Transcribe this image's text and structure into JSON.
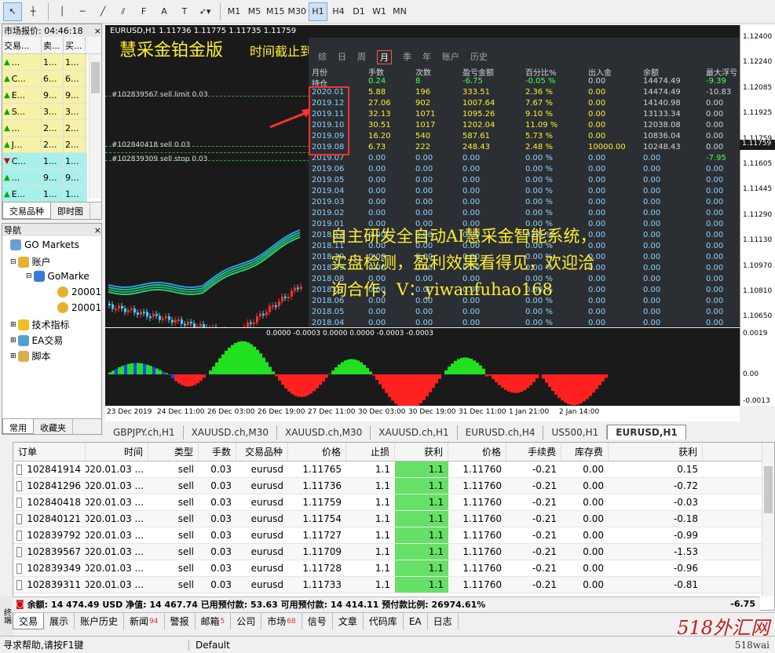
{
  "toolbar": {
    "timeframes": [
      "M1",
      "M5",
      "M15",
      "M30",
      "H1",
      "H4",
      "D1",
      "W1",
      "MN"
    ],
    "active": "H1"
  },
  "market_watch": {
    "title": "市场报价: 04:46:18",
    "headers": [
      "交易...",
      "卖...",
      "买..."
    ],
    "rows": [
      {
        "sym": "...",
        "bid": "1...",
        "ask": "1...",
        "dir": "up",
        "bg": "#f6f2a8"
      },
      {
        "sym": "C...",
        "bid": "6...",
        "ask": "6...",
        "dir": "up",
        "bg": "#f6f2a8"
      },
      {
        "sym": "E...",
        "bid": "9...",
        "ask": "9...",
        "dir": "up",
        "bg": "#f6f2a8"
      },
      {
        "sym": "S...",
        "bid": "3...",
        "ask": "3...",
        "dir": "up",
        "bg": "#f6f2a8"
      },
      {
        "sym": "...",
        "bid": "2...",
        "ask": "2...",
        "dir": "up",
        "bg": "#f6f2a8"
      },
      {
        "sym": "J...",
        "bid": "2...",
        "ask": "2...",
        "dir": "up",
        "bg": "#f6f2a8"
      },
      {
        "sym": "C...",
        "bid": "1...",
        "ask": "1...",
        "dir": "down",
        "bg": "#a8f0ea"
      },
      {
        "sym": "...",
        "bid": "9...",
        "ask": "9...",
        "dir": "up",
        "bg": "#a8f0ea"
      },
      {
        "sym": "E...",
        "bid": "1...",
        "ask": "1...",
        "dir": "up",
        "bg": "#a8f0ea"
      }
    ],
    "tabs": [
      "交易品种",
      "即时图"
    ]
  },
  "navigator": {
    "title": "导航",
    "items": [
      "GO Markets",
      "账户",
      "GoMarke",
      "20001",
      "20001",
      "技术指标",
      "EA交易",
      "脚本"
    ],
    "tabs": [
      "常用",
      "收藏夹"
    ]
  },
  "chart": {
    "header": "EURUSD,H1  1.11736 1.11775 1.11735 1.11759",
    "overlay_title": "慧采金铂金版",
    "overlay_notice": "时间截止到 2020.05.11，到期请联系客服!",
    "order_lines": [
      "#102839567 sell limit 0.03",
      "#102840418 sell 0.03",
      "#102839309 sell stop 0.03"
    ],
    "promo": [
      "自主研发全自动AI慧采金智能系统，",
      "实盘检测，盈利效果看得见，欢迎洽",
      "询合作，V：yiwanfuhao168"
    ],
    "price_axis": [
      "1.12400",
      "1.12240",
      "1.12085",
      "1.11925",
      "1.11759",
      "1.11605",
      "1.11445",
      "1.11290",
      "1.11130",
      "1.10970",
      "1.10810",
      "1.10650"
    ],
    "ind_axis": [
      "0.0019",
      "0.00",
      "-0.0013"
    ],
    "ind_header": "0.0000 -0.0003 0.0000 0.0000 -0.0003 -0.0003",
    "time_axis": [
      "23 Dec 2019",
      "24 Dec 11:00",
      "26 Dec 03:00",
      "26 Dec 19:00",
      "27 Dec 11:00",
      "30 Dec 03:00",
      "30 Dec 19:00",
      "31 Dec 11:00",
      "1 Jan 21:00",
      "2 Jan 14:00"
    ]
  },
  "stats": {
    "tabs": [
      "综",
      "日",
      "周",
      "月",
      "季",
      "年",
      "账户",
      "历史"
    ],
    "headers": [
      "月份",
      "手数",
      "次数",
      "盈亏金额",
      "百分比%",
      "出入金",
      "余额",
      "最大浮亏"
    ],
    "position_row": [
      "持仓",
      "0.24",
      "8",
      "-6.75",
      "-0.05 %",
      "0.00",
      "14474.49",
      "-9.39"
    ],
    "rows": [
      [
        "2020.01",
        "5.88",
        "196",
        "333.51",
        "2.36 %",
        "0.00",
        "14474.49",
        "-10.83"
      ],
      [
        "2019.12",
        "27.06",
        "902",
        "1007.64",
        "7.67 %",
        "0.00",
        "14140.98",
        "0.00"
      ],
      [
        "2019.11",
        "32.13",
        "1071",
        "1095.26",
        "9.10 %",
        "0.00",
        "13133.34",
        "0.00"
      ],
      [
        "2019.10",
        "30.51",
        "1017",
        "1202.04",
        "11.09 %",
        "0.00",
        "12038.08",
        "0.00"
      ],
      [
        "2019.09",
        "16.20",
        "540",
        "587.61",
        "5.73 %",
        "0.00",
        "10836.04",
        "0.00"
      ],
      [
        "2019.08",
        "6.73",
        "222",
        "248.43",
        "2.48 %",
        "10000.00",
        "10248.43",
        "0.00"
      ],
      [
        "2019.07",
        "0.00",
        "0.00",
        "0.00",
        "0.00 %",
        "0.00",
        "0.00",
        "-7.95"
      ],
      [
        "2019.06",
        "0.00",
        "0.00",
        "0.00",
        "0.00 %",
        "0.00",
        "0.00",
        "0.00"
      ],
      [
        "2019.05",
        "0.00",
        "0.00",
        "0.00",
        "0.00 %",
        "0.00",
        "0.00",
        "0.00"
      ],
      [
        "2019.04",
        "0.00",
        "0.00",
        "0.00",
        "0.00 %",
        "0.00",
        "0.00",
        "0.00"
      ],
      [
        "2019.03",
        "0.00",
        "0.00",
        "0.00",
        "0.00 %",
        "0.00",
        "0.00",
        "0.00"
      ],
      [
        "2019.02",
        "0.00",
        "0.00",
        "0.00",
        "0.00 %",
        "0.00",
        "0.00",
        "0.00"
      ],
      [
        "2019.01",
        "0.00",
        "0.00",
        "0.00",
        "0.00 %",
        "0.00",
        "0.00",
        "0.00"
      ],
      [
        "2018.12",
        "0.00",
        "0.00",
        "0.00",
        "0.00 %",
        "0.00",
        "0.00",
        "0.00"
      ],
      [
        "2018.11",
        "0.00",
        "0.00",
        "0.00",
        "0.00 %",
        "0.00",
        "0.00",
        "0.00"
      ],
      [
        "2018.10",
        "0.00",
        "0.00",
        "0.00",
        "0.00 %",
        "0.00",
        "0.00",
        "0.00"
      ],
      [
        "2018.09",
        "0.00",
        "0.00",
        "0.00",
        "0.00 %",
        "0.00",
        "0.00",
        "0.00"
      ],
      [
        "2018.08",
        "0.00",
        "0.00",
        "0.00",
        "0.00 %",
        "0.00",
        "0.00",
        "0.00"
      ],
      [
        "2018.07",
        "0.00",
        "0.00",
        "0.00",
        "0.00 %",
        "0.00",
        "0.00",
        "0.00"
      ],
      [
        "2018.06",
        "0.00",
        "0.00",
        "0.00",
        "0.00 %",
        "0.00",
        "0.00",
        "0.00"
      ],
      [
        "2018.05",
        "0.00",
        "0.00",
        "0.00",
        "0.00 %",
        "0.00",
        "0.00",
        "0.00"
      ],
      [
        "2018.04",
        "0.00",
        "0.00",
        "0.00",
        "0.00 %",
        "0.00",
        "0.00",
        "0.00"
      ]
    ]
  },
  "chart_tabs": [
    "GBPJPY.ch,H1",
    "XAUUSD.ch,M30",
    "XAUUSD.ch,M30",
    "XAUUSD.ch,H1",
    "EURUSD.ch,H4",
    "US500,H1",
    "EURUSD,H1"
  ],
  "trade": {
    "headers": [
      "订单",
      "时间",
      "类型",
      "手数",
      "交易品种",
      "价格",
      "止损",
      "获利",
      "价格",
      "手续费",
      "库存费",
      "获利"
    ],
    "rows": [
      [
        "102841914",
        "2020.01.03 ...",
        "sell",
        "0.03",
        "eurusd",
        "1.11765",
        "1.1",
        "1.1",
        "1.11760",
        "-0.21",
        "0.00",
        "0.15"
      ],
      [
        "102841296",
        "2020.01.03 ...",
        "sell",
        "0.03",
        "eurusd",
        "1.11736",
        "1.1",
        "1.1",
        "1.11760",
        "-0.21",
        "0.00",
        "-0.72"
      ],
      [
        "102840418",
        "2020.01.03 ...",
        "sell",
        "0.03",
        "eurusd",
        "1.11759",
        "1.1",
        "1.1",
        "1.11760",
        "-0.21",
        "0.00",
        "-0.03"
      ],
      [
        "102840121",
        "2020.01.03 ...",
        "sell",
        "0.03",
        "eurusd",
        "1.11754",
        "1.1",
        "1.1",
        "1.11760",
        "-0.21",
        "0.00",
        "-0.18"
      ],
      [
        "102839792",
        "2020.01.03 ...",
        "sell",
        "0.03",
        "eurusd",
        "1.11727",
        "1.1",
        "1.1",
        "1.11760",
        "-0.21",
        "0.00",
        "-0.99"
      ],
      [
        "102839567",
        "2020.01.03 ...",
        "sell",
        "0.03",
        "eurusd",
        "1.11709",
        "1.1",
        "1.1",
        "1.11760",
        "-0.21",
        "0.00",
        "-1.53"
      ],
      [
        "102839349",
        "2020.01.03 ...",
        "sell",
        "0.03",
        "eurusd",
        "1.11728",
        "1.1",
        "1.1",
        "1.11760",
        "-0.21",
        "0.00",
        "-0.96"
      ],
      [
        "102839311",
        "2020.01.03 ...",
        "sell",
        "0.03",
        "eurusd",
        "1.11733",
        "1.1",
        "1.1",
        "1.11760",
        "-0.21",
        "0.00",
        "-0.81"
      ]
    ],
    "balance_line": "余额: 14 474.49 USD  净值: 14 467.74  已用预付款: 53.63  可用预付款: 14 414.11  预付款比例: 26974.61%",
    "balance_total": "-6.75",
    "tabs": [
      {
        "l": "交易",
        "b": ""
      },
      {
        "l": "展示",
        "b": ""
      },
      {
        "l": "账户历史",
        "b": ""
      },
      {
        "l": "新闻",
        "b": "94"
      },
      {
        "l": "警报",
        "b": ""
      },
      {
        "l": "邮箱",
        "b": "5"
      },
      {
        "l": "公司",
        "b": ""
      },
      {
        "l": "市场",
        "b": "68"
      },
      {
        "l": "信号",
        "b": ""
      },
      {
        "l": "文章",
        "b": ""
      },
      {
        "l": "代码库",
        "b": ""
      },
      {
        "l": "EA",
        "b": ""
      },
      {
        "l": "日志",
        "b": ""
      }
    ]
  },
  "status": {
    "help": "寻求帮助,请按F1键",
    "profile": "Default"
  },
  "side_label": "终端",
  "watermark": {
    "site": "518外汇网",
    "url": "518wai"
  }
}
